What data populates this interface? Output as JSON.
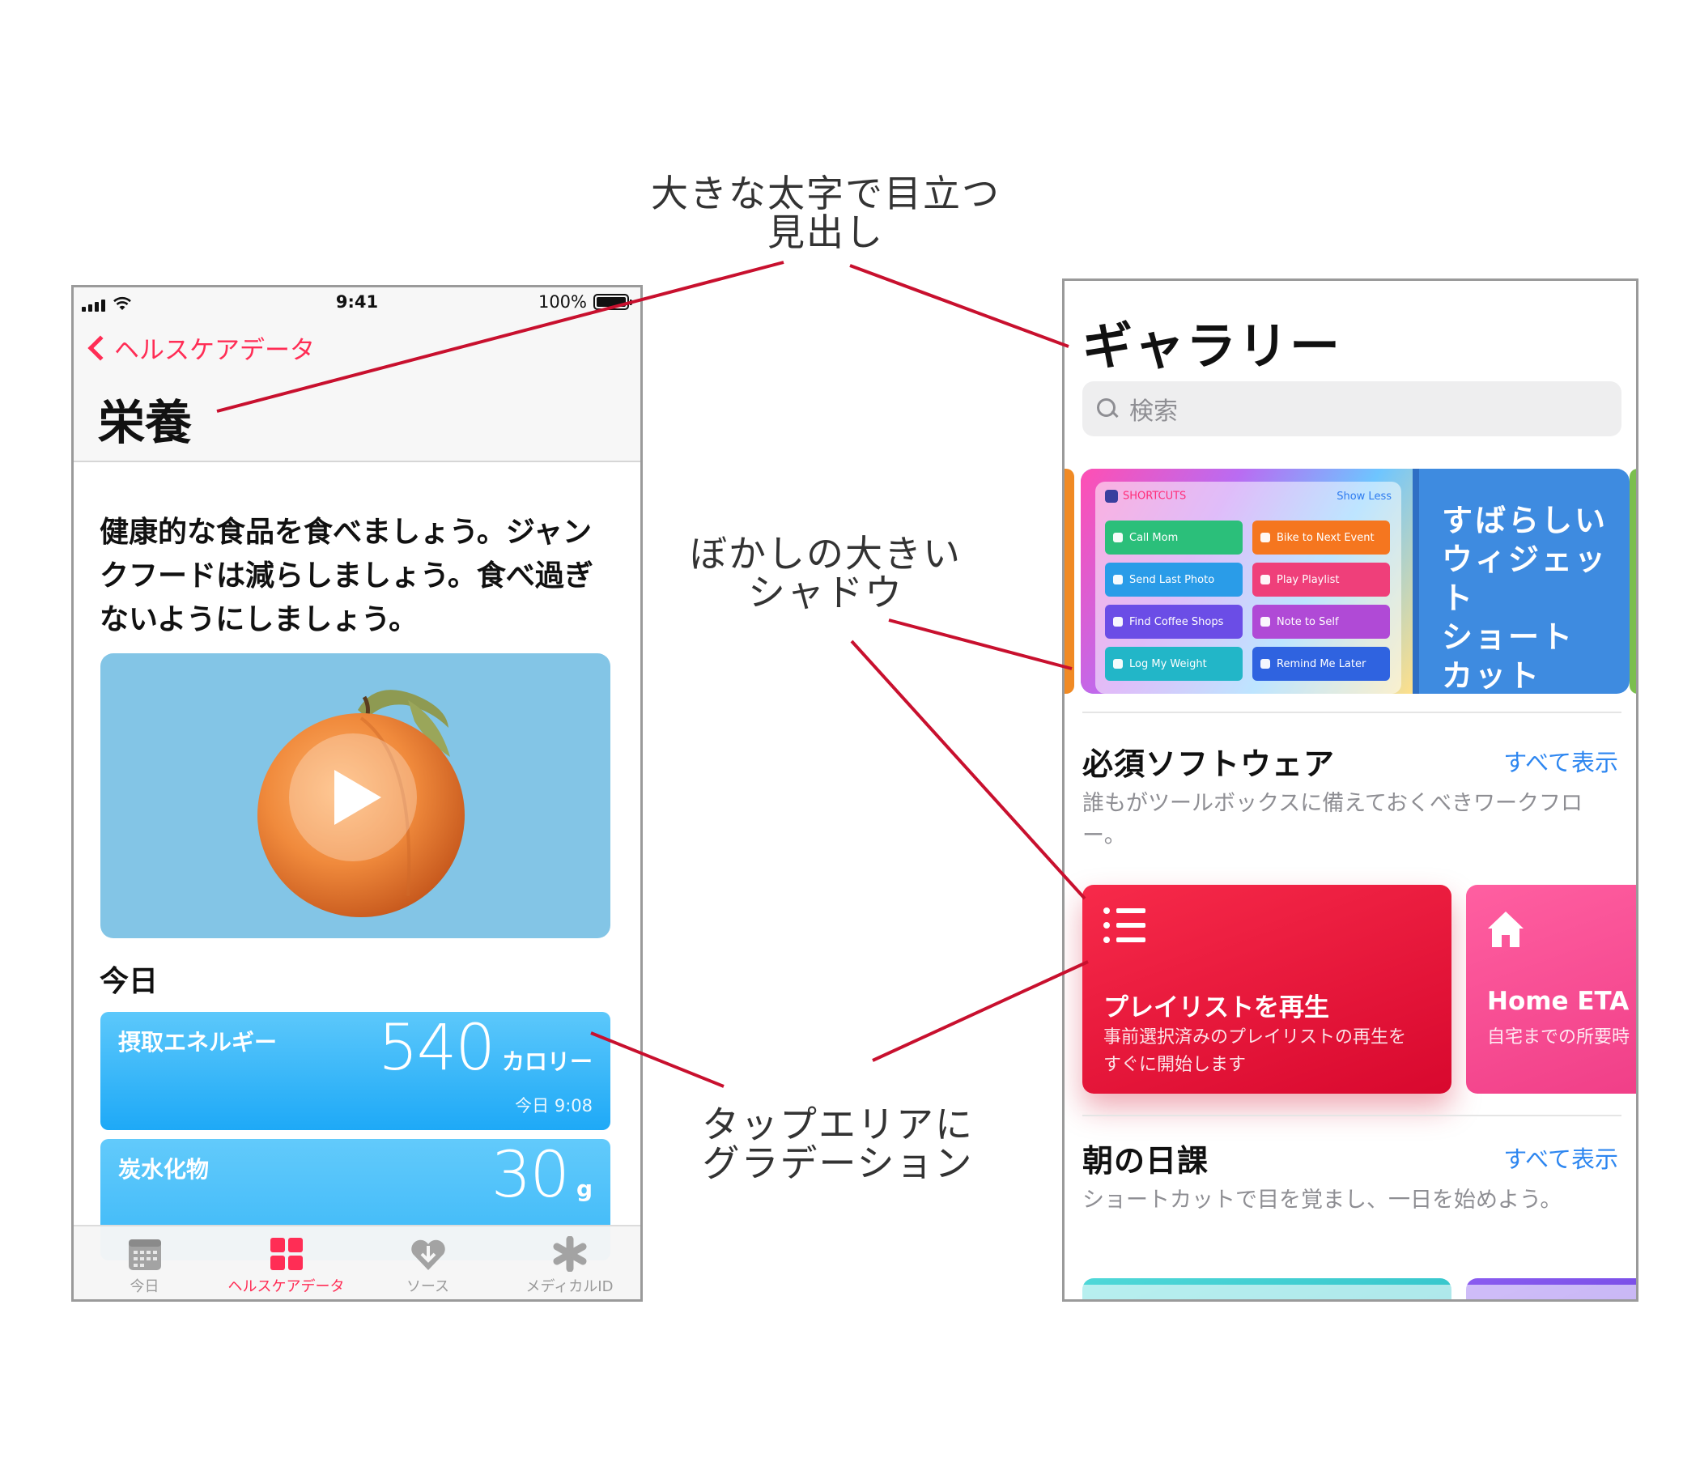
{
  "annotations": {
    "heading": "大きな太字で目立つ\n見出し",
    "shadow": "ぼかしの大きい\nシャドウ",
    "gradient": "タップエリアに\nグラデーション"
  },
  "colors": {
    "leader_line": "#c8102e",
    "health_accent": "#ff2d55",
    "shortcuts_link": "#2d86f0"
  },
  "health_app": {
    "status": {
      "time": "9:41",
      "battery": "100%"
    },
    "back_label": "ヘルスケアデータ",
    "title": "栄養",
    "description": "健康的な食品を食べましょう。ジャンクフードは減らしましょう。食べ過ぎないようにしましょう。",
    "today_heading": "今日",
    "metrics": [
      {
        "label": "摂取エネルギー",
        "value": "540",
        "unit": "カロリー",
        "time": "今日 9:08"
      },
      {
        "label": "炭水化物",
        "value": "30",
        "unit": "g"
      }
    ],
    "tabs": [
      {
        "label": "今日",
        "icon": "calendar-icon",
        "active": false
      },
      {
        "label": "ヘルスケアデータ",
        "icon": "grid-icon",
        "active": true
      },
      {
        "label": "ソース",
        "icon": "heart-download-icon",
        "active": false
      },
      {
        "label": "メディカルID",
        "icon": "asterisk-icon",
        "active": false
      }
    ]
  },
  "shortcuts_app": {
    "title": "ギャラリー",
    "search_placeholder": "検索",
    "banner": {
      "widget_app_name": "SHORTCUTS",
      "widget_show_less": "Show Less",
      "widget_buttons": [
        {
          "label": "Call Mom",
          "color": "#2bbf7a"
        },
        {
          "label": "Bike to Next Event",
          "color": "#f5761f"
        },
        {
          "label": "Send Last Photo",
          "color": "#2a9ce8"
        },
        {
          "label": "Play Playlist",
          "color": "#ef3f7a"
        },
        {
          "label": "Find Coffee Shops",
          "color": "#6b4de6"
        },
        {
          "label": "Note to Self",
          "color": "#b04ad6"
        },
        {
          "label": "Log My Weight",
          "color": "#22b6c8"
        },
        {
          "label": "Remind Me Later",
          "color": "#2f63e0"
        }
      ],
      "text": "すばらしい\nウィジェット\nショート\nカット"
    },
    "sections": [
      {
        "title": "必須ソフトウェア",
        "see_all": "すべて表示",
        "subtitle": "誰もがツールボックスに備えておくべきワークフロー。",
        "cards": [
          {
            "title": "プレイリストを再生",
            "subtitle": "事前選択済みのプレイリストの再生を\nすぐに開始します",
            "icon": "list-icon"
          },
          {
            "title": "Home ETA",
            "subtitle": "自宅までの所要時",
            "icon": "house-icon"
          }
        ]
      },
      {
        "title": "朝の日課",
        "see_all": "すべて表示",
        "subtitle": "ショートカットで目を覚まし、一日を始めよう。"
      }
    ]
  }
}
